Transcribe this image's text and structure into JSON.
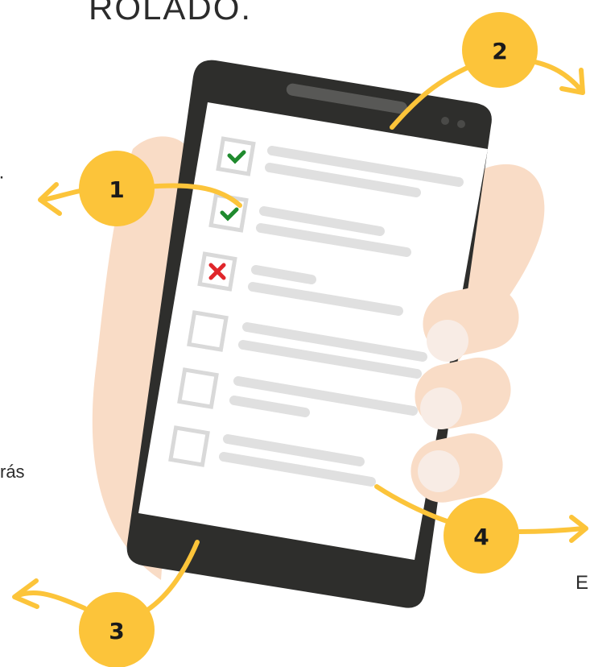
{
  "texts": {
    "top_fragment": "ROLADO.",
    "left_fragment": "rás",
    "right_fragment": "E",
    "edge_mark": "·"
  },
  "badges": [
    {
      "label": "1"
    },
    {
      "label": "2"
    },
    {
      "label": "3"
    },
    {
      "label": "4"
    }
  ],
  "checklist": [
    {
      "status": "checked"
    },
    {
      "status": "checked"
    },
    {
      "status": "crossed"
    },
    {
      "status": "empty"
    },
    {
      "status": "empty"
    },
    {
      "status": "empty"
    }
  ],
  "colors": {
    "badge": "#fcc43a",
    "arrow": "#fcc43a",
    "phone": "#2e2e2c",
    "screen": "#ffffff",
    "skin": "#f9dcc6",
    "fingertip": "#f8ece5",
    "check": "#1f8a2e",
    "cross": "#e0262b",
    "placeholder": "#e0e0e0"
  },
  "icons": [
    "checkmark-icon",
    "cross-icon",
    "arrow-icon"
  ]
}
